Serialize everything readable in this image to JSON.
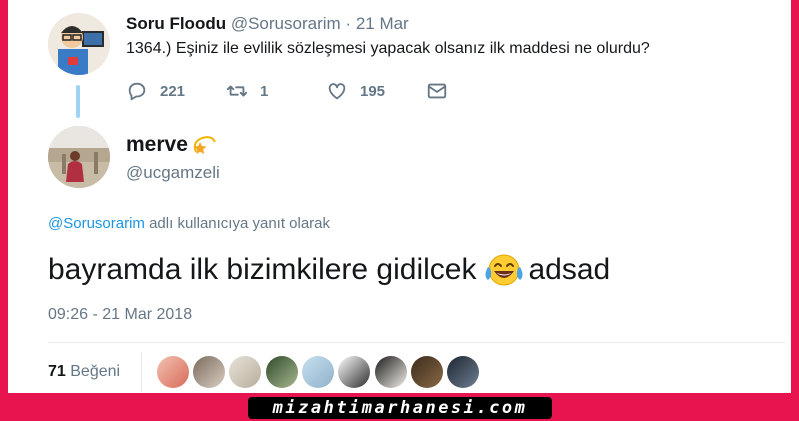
{
  "tweet_parent": {
    "display_name": "Soru Floodu",
    "handle": "@Sorusorarim",
    "separator": "·",
    "date": "21 Mar",
    "text": "1364.) Eşiniz ile evlilik sözleşmesi yapacak olsanız ilk maddesi ne olurdu?",
    "actions": {
      "reply_count": "221",
      "retweet_count": "1",
      "like_count": "195"
    }
  },
  "tweet_reply": {
    "display_name": "merve",
    "handle": "@ucgamzeli",
    "reply_context": {
      "mention": "@Sorusorarim",
      "suffix": "adlı kullanıcıya yanıt olarak"
    },
    "text_before": "bayramda ilk bizimkilere gidilcek",
    "text_after": "adsad",
    "emoji": "face-with-tears-of-joy",
    "timestamp": "09:26 - 21 Mar 2018",
    "likes_count": "71",
    "likes_label": "Beğeni",
    "likers_count": 9
  },
  "watermark": "mizahtimarhanesi.com",
  "colors": {
    "frame": "#e8144f",
    "link": "#1b95e0",
    "muted": "#657786",
    "text": "#14171a",
    "thread": "#9fd3f6"
  },
  "icons": [
    "reply-icon",
    "retweet-icon",
    "like-icon",
    "message-icon",
    "dizzy-star-icon"
  ]
}
